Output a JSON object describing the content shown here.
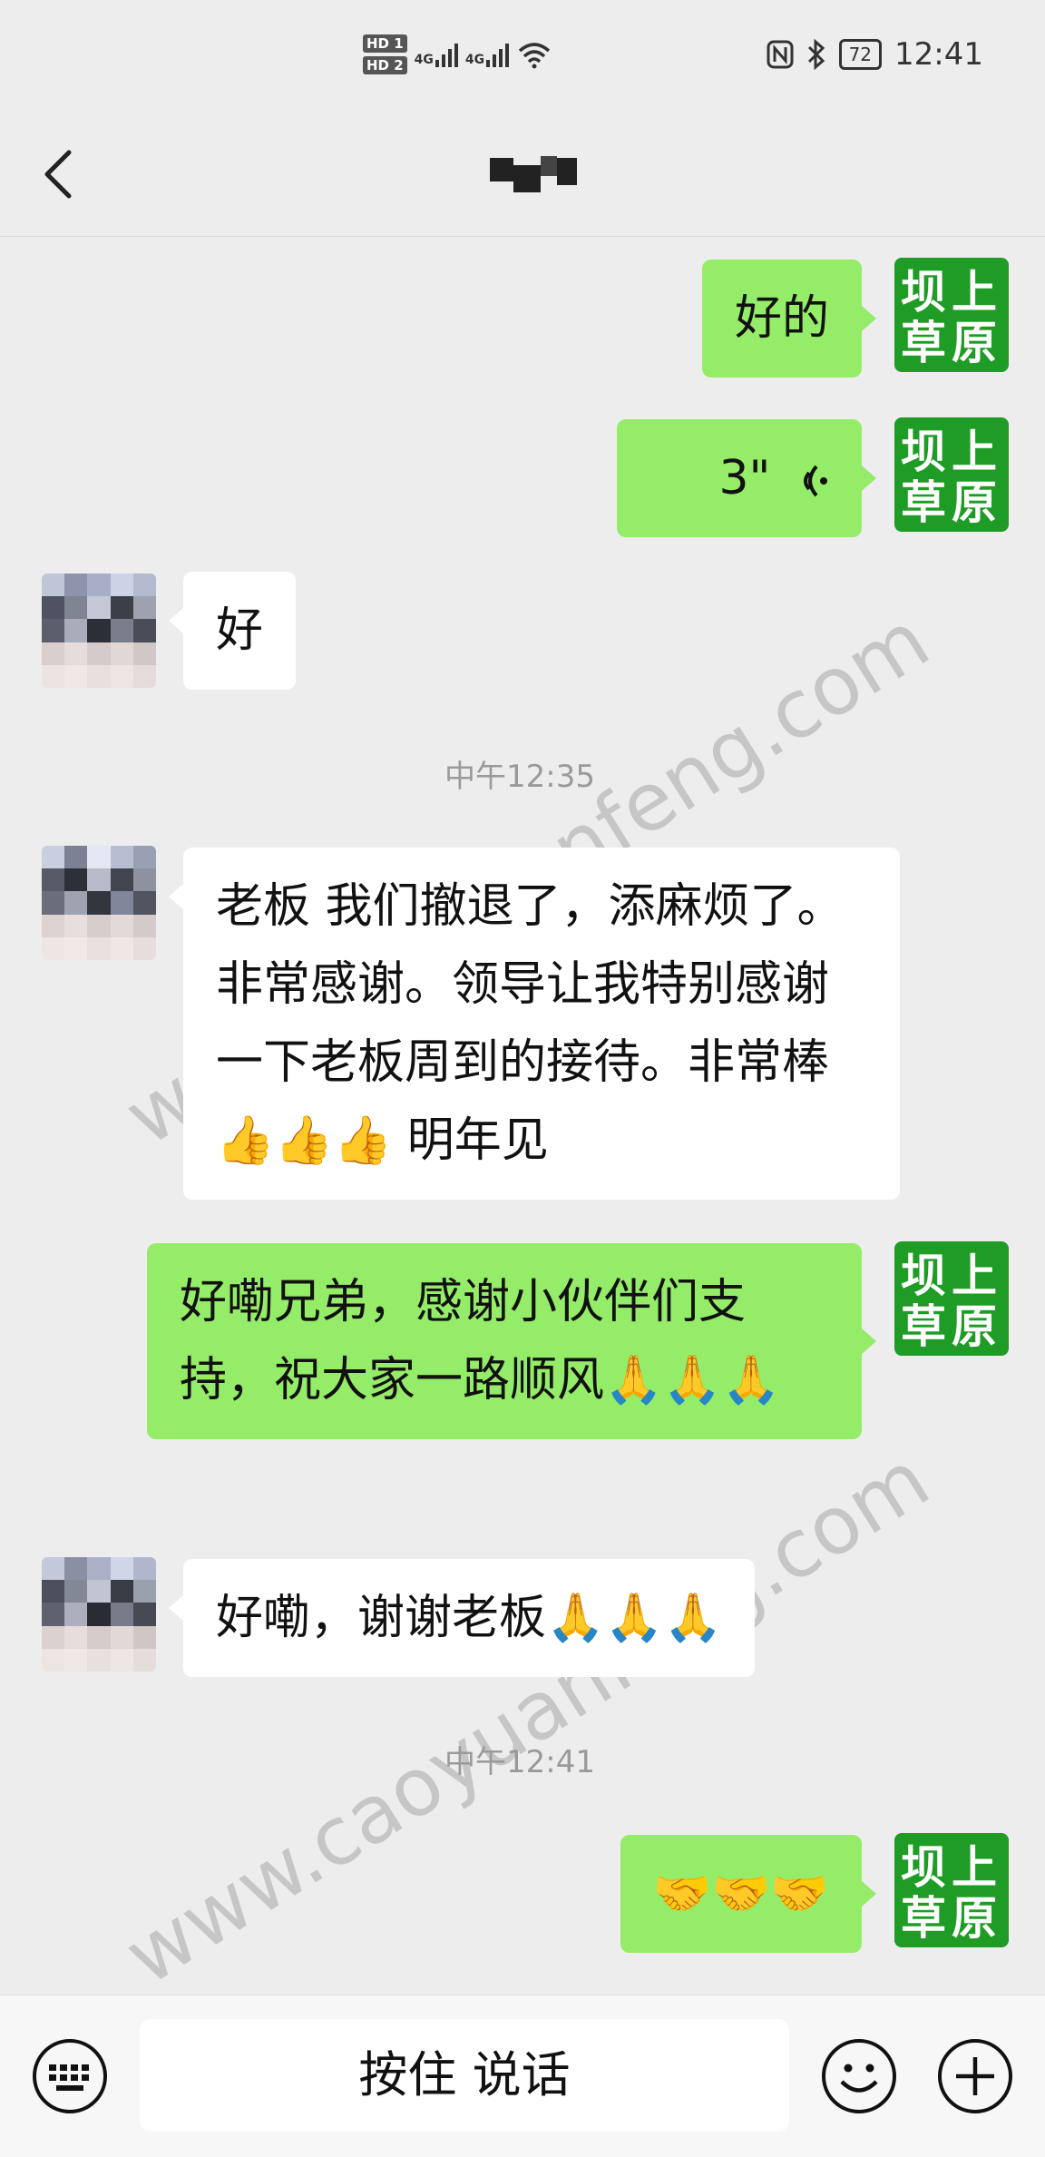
{
  "status_bar": {
    "hd1": "HD 1",
    "hd2": "HD 2",
    "net1": "4G",
    "net2": "4G",
    "battery": "72",
    "time": "12:41",
    "icons": [
      "nfc-icon",
      "bluetooth-icon",
      "wifi-icon"
    ]
  },
  "header": {
    "back_icon": "chevron-left-icon",
    "more_icon": "more-dots-icon"
  },
  "self_avatar": {
    "line1": "坝上",
    "line2": "草原",
    "color": "#1e9c25"
  },
  "messages": [
    {
      "side": "out",
      "text": "好的"
    },
    {
      "side": "out",
      "type": "voice",
      "duration": "3\""
    },
    {
      "side": "in",
      "text": "好"
    },
    {
      "type": "time",
      "text": "中午12:35"
    },
    {
      "side": "in",
      "text": "老板 我们撤退了，添麻烦了。非常感谢。领导让我特别感谢一下老板周到的接待。非常棒👍👍👍 明年见"
    },
    {
      "side": "out",
      "text": "好嘞兄弟，感谢小伙伴们支持，祝大家一路顺风🙏🙏🙏"
    },
    {
      "side": "in",
      "text": "好嘞，谢谢老板🙏🙏🙏"
    },
    {
      "type": "time",
      "text": "中午12:41"
    },
    {
      "side": "out",
      "text": "🤝🤝🤝"
    }
  ],
  "watermark": "www.caoyuanfeng.com",
  "input_bar": {
    "hold_to_talk": "按住 说话",
    "left_icon": "keyboard-icon",
    "emoji_icon": "smile-icon",
    "plus_icon": "plus-icon"
  },
  "colors": {
    "outgoing_bubble": "#95ec69",
    "incoming_bubble": "#ffffff",
    "background": "#ededed"
  }
}
